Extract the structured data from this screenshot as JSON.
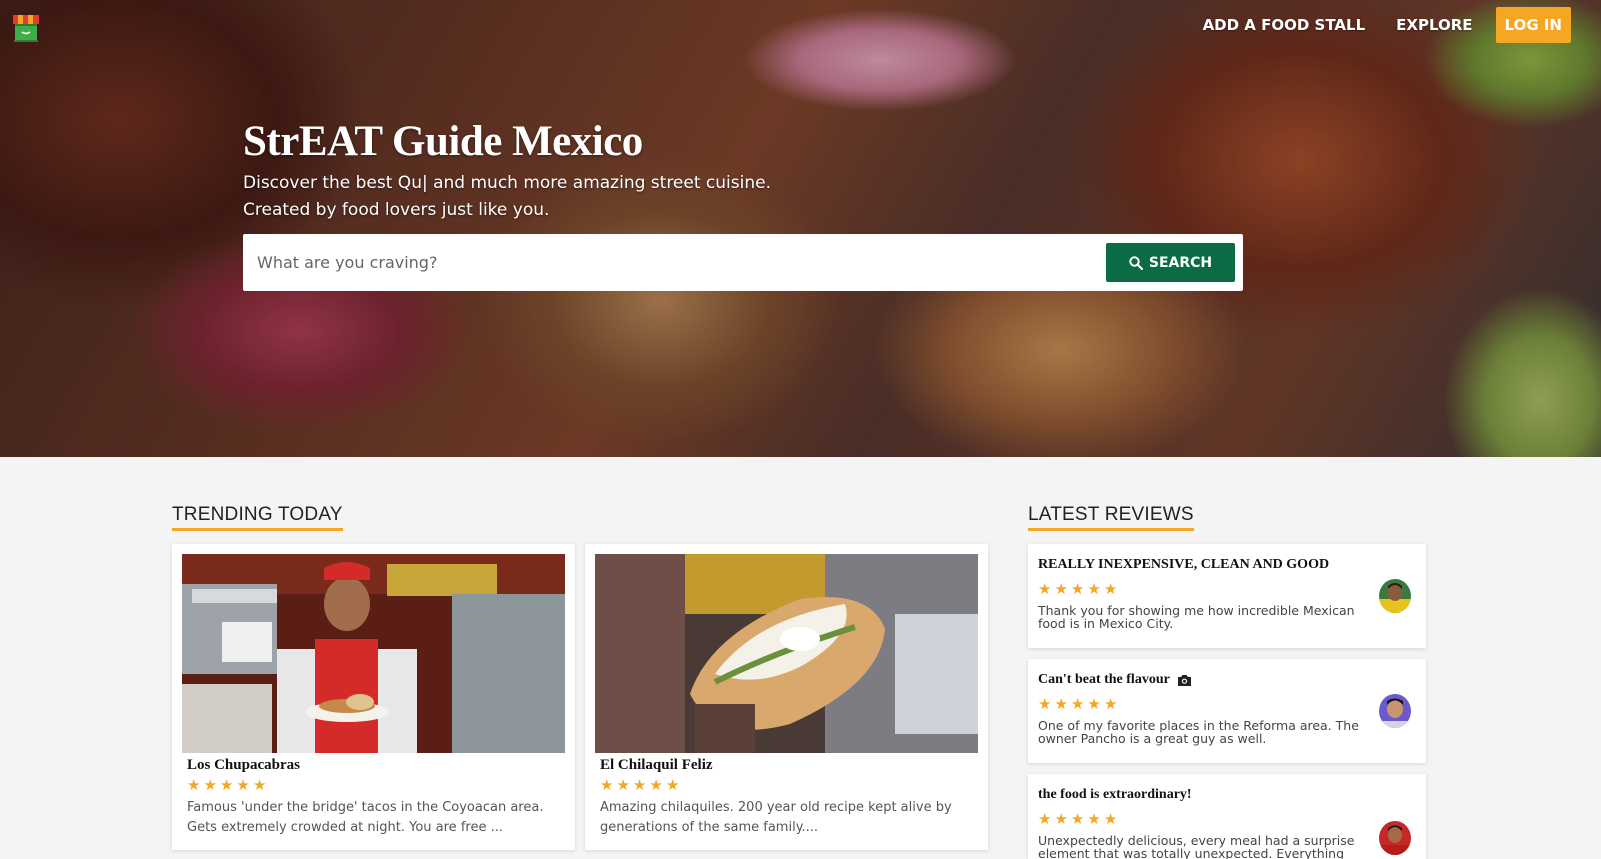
{
  "nav": {
    "add_stall": "ADD A FOOD STALL",
    "explore": "EXPLORE",
    "login": "LOG IN"
  },
  "hero": {
    "title": "StrEAT Guide Mexico",
    "subtitle_line1": "Discover the best Qu| and much more amazing street cuisine.",
    "subtitle_line2": "Created by food lovers just like you."
  },
  "search": {
    "placeholder": "What are you craving?",
    "value": "",
    "button_label": "SEARCH",
    "icon": "search-icon"
  },
  "trending": {
    "title": "TRENDING TODAY",
    "items": [
      {
        "name": "Los Chupacabras",
        "rating": 5,
        "description": "Famous 'under the bridge' tacos in the Coyoacan area. Gets extremely crowded at night. You are free ..."
      },
      {
        "name": "El Chilaquil Feliz",
        "rating": 5,
        "description": "Amazing chilaquiles. 200 year old recipe kept alive by generations of the same family...."
      }
    ]
  },
  "reviews": {
    "title": "LATEST REVIEWS",
    "items": [
      {
        "title": "REALLY INEXPENSIVE, CLEAN AND GOOD",
        "rating": 5,
        "text": "Thank you for showing me how incredible Mexican food is in Mexico City.",
        "has_photo": false
      },
      {
        "title": "Can't beat the flavour",
        "rating": 5,
        "text": "One of my favorite places in the Reforma area. The owner Pancho is a great guy as well.",
        "has_photo": true,
        "photo_icon": "camera-icon"
      },
      {
        "title": "the food is extraordinary!",
        "rating": 5,
        "text": "Unexpectedly delicious, every meal had a surprise element that was totally unexpected. Everything",
        "has_photo": false
      }
    ]
  },
  "colors": {
    "accent": "#f5a623",
    "search_button": "#0b6b45",
    "star": "#f5a623"
  }
}
